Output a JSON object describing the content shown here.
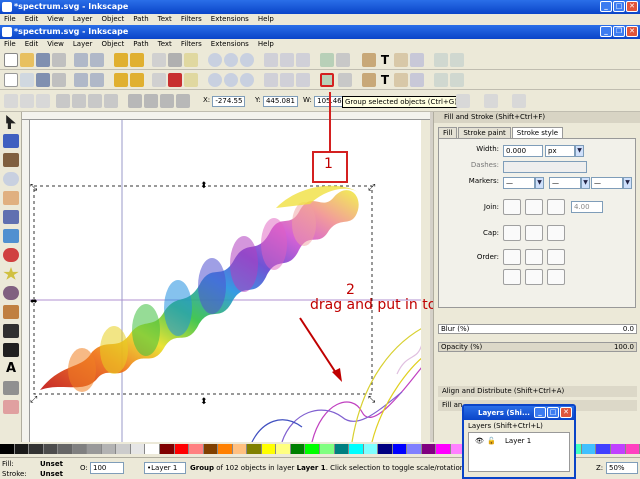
{
  "window": {
    "outer_title": "*spectrum.svg - Inkscape",
    "inner_title": "*spectrum.svg - Inkscape"
  },
  "menu": [
    "File",
    "Edit",
    "View",
    "Layer",
    "Object",
    "Path",
    "Text",
    "Filters",
    "Extensions",
    "Help"
  ],
  "coords": {
    "x_label": "X:",
    "x_value": "-274.55",
    "y_label": "Y:",
    "y_value": "445.081",
    "w_label": "W:",
    "w_value": "105.460"
  },
  "tooltip": "Group selected objects (Ctrl+G)",
  "panel": {
    "title": "Fill and Stroke (Shift+Ctrl+F)",
    "tabs": [
      "Fill",
      "Stroke paint",
      "Stroke style"
    ],
    "width_label": "Width:",
    "width_value": "0.000",
    "width_unit": "px",
    "dashes_label": "Dashes:",
    "markers_label": "Markers:",
    "join_label": "Join:",
    "miter_value": "4.00",
    "cap_label": "Cap:",
    "order_label": "Order:",
    "blur_label": "Blur (%)",
    "blur_value": "0.0",
    "opacity_label": "Opacity (%)",
    "opacity_value": "100.0",
    "align_title": "Align and Distribute (Shift+Ctrl+A)",
    "fill_title_short": "Fill an"
  },
  "layers_window": {
    "title": "Layers (Shi...",
    "header": "Layers (Shift+Ctrl+L)",
    "layer_name": "Layer 1"
  },
  "annotations": {
    "step1": "1",
    "step2_num": "2",
    "step2_text": "drag and put in to the lines"
  },
  "status": {
    "fill_label": "Fill:",
    "fill_value": "Unset",
    "stroke_label": "Stroke:",
    "stroke_value": "Unset",
    "opacity_label": "O:",
    "opacity_value": "100",
    "layer": "•Layer 1",
    "message_prefix": "Group",
    "message_rest": " of 102 objects in layer ",
    "message_layer": "Layer 1",
    "message_end": ". Click selection to toggle scale/rotation handles.",
    "zoom_label": "Z:",
    "zoom_value": "50%"
  },
  "colors": {
    "titlebar": "#0a44c8",
    "annotation": "#d42020",
    "chrome": "#ece9d8"
  }
}
